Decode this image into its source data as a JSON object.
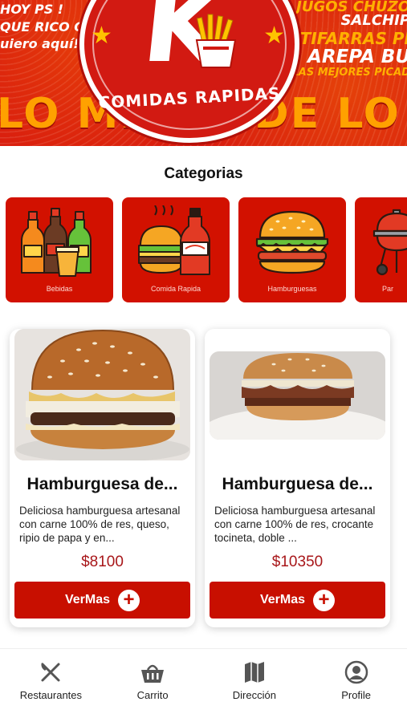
{
  "banner": {
    "left_promos": [
      "HOY PS !",
      "QUE RICO OME!!",
      "uiero aquí!"
    ],
    "right_promos": [
      "JUGOS CHUZO",
      "SALCHIP",
      "BUTIFARRAS PI",
      "AREPA BU",
      "LAS MEJORES PICAD"
    ],
    "logo_letter": "K",
    "logo_text": "COMIDAS RAPIDAS",
    "slogan": "LO MEJOR DE LO MEJOR"
  },
  "categories": {
    "title": "Categorias",
    "items": [
      {
        "label": "Bebidas",
        "icon": "bottles-icon"
      },
      {
        "label": "Comida Rapida",
        "icon": "burger-soda-icon"
      },
      {
        "label": "Hamburguesas",
        "icon": "burger-icon"
      },
      {
        "label": "Par",
        "icon": "grill-icon"
      }
    ]
  },
  "products": [
    {
      "name": "Hamburguesa de...",
      "description": "Deliciosa hamburguesa artesanal con carne 100% de res, queso, ripio de papa y en...",
      "price": "$8100",
      "button_label": "VerMas"
    },
    {
      "name": "Hamburguesa de...",
      "description": "Deliciosa hamburguesa artesanal con carne 100% de res, crocante tocineta, doble ...",
      "price": "$10350",
      "button_label": "VerMas"
    }
  ],
  "nav": {
    "items": [
      {
        "label": "Restaurantes",
        "icon": "fork-knife-icon"
      },
      {
        "label": "Carrito",
        "icon": "basket-icon"
      },
      {
        "label": "Dirección",
        "icon": "map-icon"
      },
      {
        "label": "Profile",
        "icon": "profile-icon"
      }
    ]
  },
  "colors": {
    "brand_red": "#c80f00",
    "price_red": "#a8171a",
    "banner_orange": "#ffa100"
  }
}
